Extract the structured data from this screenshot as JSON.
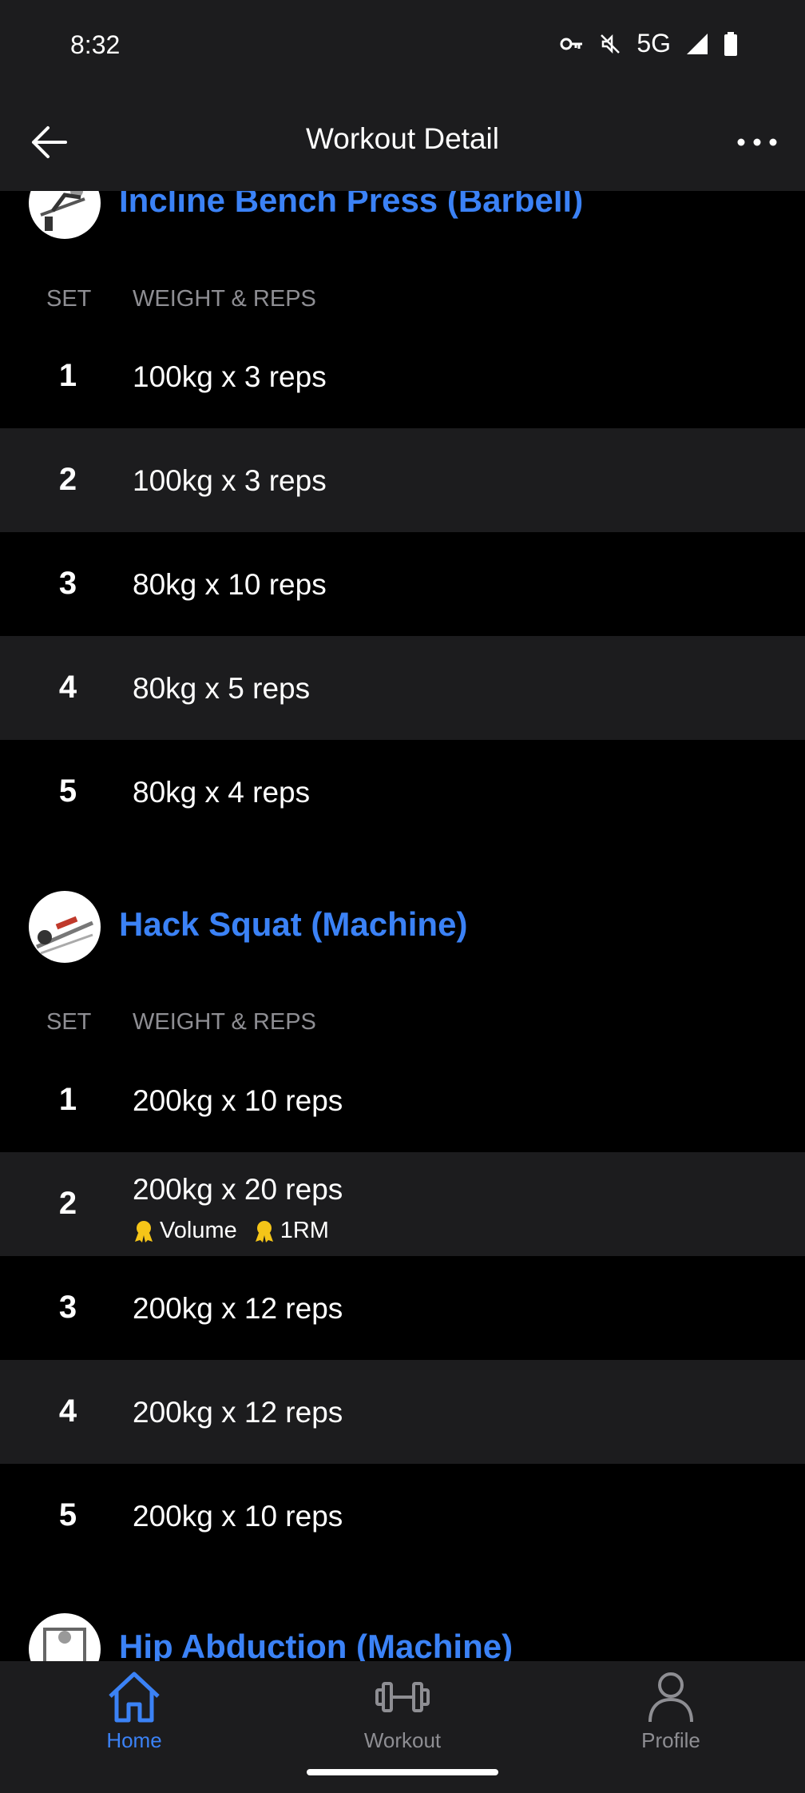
{
  "status_bar": {
    "time": "8:32",
    "network": "5G"
  },
  "app_bar": {
    "title": "Workout Detail"
  },
  "exercises": [
    {
      "name": "Incline Bench Press (Barbell)",
      "col_set": "SET",
      "col_weight_reps": "WEIGHT & REPS",
      "sets": [
        {
          "num": "1",
          "value": "100kg x 3 reps"
        },
        {
          "num": "2",
          "value": "100kg x 3 reps"
        },
        {
          "num": "3",
          "value": "80kg x 10 reps"
        },
        {
          "num": "4",
          "value": "80kg x 5 reps"
        },
        {
          "num": "5",
          "value": "80kg x 4 reps"
        }
      ]
    },
    {
      "name": "Hack Squat (Machine)",
      "col_set": "SET",
      "col_weight_reps": "WEIGHT & REPS",
      "sets": [
        {
          "num": "1",
          "value": "200kg x 10 reps"
        },
        {
          "num": "2",
          "value": "200kg x 20 reps",
          "badges": [
            "Volume",
            "1RM"
          ]
        },
        {
          "num": "3",
          "value": "200kg x 12 reps"
        },
        {
          "num": "4",
          "value": "200kg x 12 reps"
        },
        {
          "num": "5",
          "value": "200kg x 10 reps"
        }
      ]
    },
    {
      "name": "Hip Abduction (Machine)"
    }
  ],
  "bottom_nav": [
    {
      "label": "Home",
      "icon": "home-icon",
      "active": true
    },
    {
      "label": "Workout",
      "icon": "dumbbell-icon",
      "active": false
    },
    {
      "label": "Profile",
      "icon": "person-icon",
      "active": false
    }
  ],
  "colors": {
    "accent": "#3b82f6",
    "row_alt": "#1c1c1e",
    "muted": "#8e8e93",
    "medal": "#f5c518"
  }
}
